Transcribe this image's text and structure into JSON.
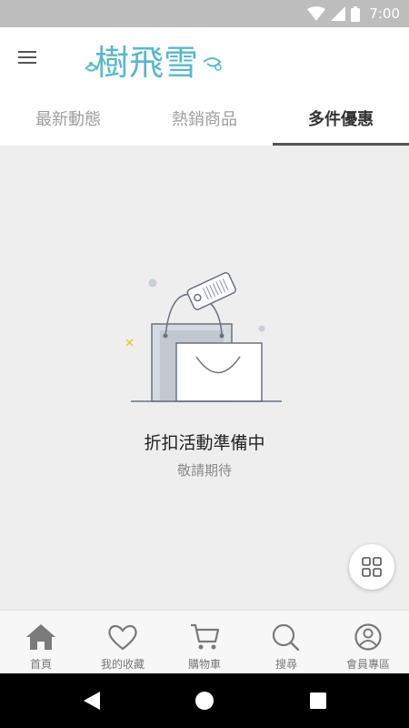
{
  "status_bar": {
    "time": "7:00",
    "icons": [
      "wifi-icon",
      "signal-icon",
      "battery-icon"
    ]
  },
  "header": {
    "menu_icon": "hamburger-menu-icon",
    "logo_text": "樹飛雪",
    "brand_color": "#5bb8c8"
  },
  "tabs": [
    {
      "label": "最新動態",
      "active": false
    },
    {
      "label": "熱銷商品",
      "active": false
    },
    {
      "label": "多件優惠",
      "active": true
    }
  ],
  "empty_state": {
    "illustration": "shopping-bag-with-tag-icon",
    "title": "折扣活動準備中",
    "subtitle": "敬請期待"
  },
  "fab": {
    "icon": "grid-icon"
  },
  "bottom_nav": [
    {
      "label": "首頁",
      "icon": "home-icon"
    },
    {
      "label": "我的收藏",
      "icon": "heart-icon"
    },
    {
      "label": "購物車",
      "icon": "cart-icon"
    },
    {
      "label": "搜尋",
      "icon": "search-icon"
    },
    {
      "label": "會員專區",
      "icon": "user-icon"
    }
  ],
  "system_nav": [
    "back-icon",
    "home-circle-icon",
    "recents-icon"
  ]
}
